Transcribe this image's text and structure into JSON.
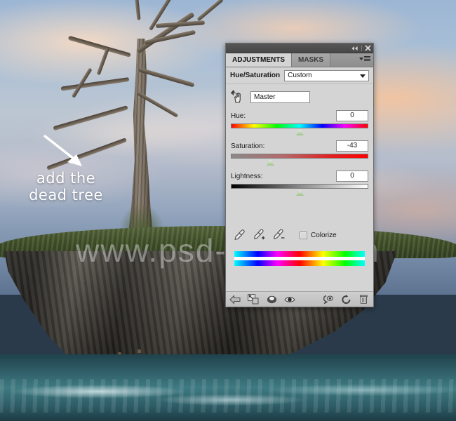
{
  "scene": {
    "annotation": {
      "line1": "add the",
      "line2": "dead tree",
      "arrow_icon": "arrow-down-right-icon"
    },
    "watermark": "www.psd-dude.com"
  },
  "panel": {
    "titlebar": {
      "collapse_icon": "double-chevron-left-icon",
      "close_icon": "close-icon"
    },
    "tabs": [
      {
        "label": "ADJUSTMENTS",
        "active": true
      },
      {
        "label": "MASKS",
        "active": false
      }
    ],
    "menu_icon": "panel-menu-icon",
    "preset": {
      "label": "Hue/Saturation",
      "value": "Custom",
      "caret_icon": "chevron-down-icon"
    },
    "channel": {
      "oia_icon": "on-image-adjustment-hand-icon",
      "value": "Master",
      "caret_icon": "chevron-down-icon"
    },
    "sliders": [
      {
        "label": "Hue:",
        "value": "0",
        "thumb_pct": 50,
        "track": "hue"
      },
      {
        "label": "Saturation:",
        "value": "-43",
        "thumb_pct": 28.5,
        "track": "sat"
      },
      {
        "label": "Lightness:",
        "value": "0",
        "thumb_pct": 50,
        "track": "light"
      }
    ],
    "tools": [
      {
        "icon": "eyedropper-icon"
      },
      {
        "icon": "eyedropper-plus-icon"
      },
      {
        "icon": "eyedropper-minus-icon"
      }
    ],
    "colorize": {
      "label": "Colorize",
      "checked": false
    },
    "footer_buttons": [
      {
        "icon": "back-arrow-icon"
      },
      {
        "icon": "clip-to-layer-icon"
      },
      {
        "icon": "adjustment-circle-icon"
      },
      {
        "icon": "eye-visibility-icon"
      },
      {
        "icon": "preview-toggle-icon"
      },
      {
        "icon": "reset-icon"
      },
      {
        "icon": "delete-trash-icon"
      }
    ]
  },
  "colors": {
    "panel_bg": "#d4d4d4",
    "titlebar": "#4f4f4f",
    "tab_active_bg": "#d4d4d4",
    "thumb_green": "#9fc28e",
    "annotation_text": "#ffffff",
    "watermark": "rgba(255,255,255,0.40)"
  }
}
